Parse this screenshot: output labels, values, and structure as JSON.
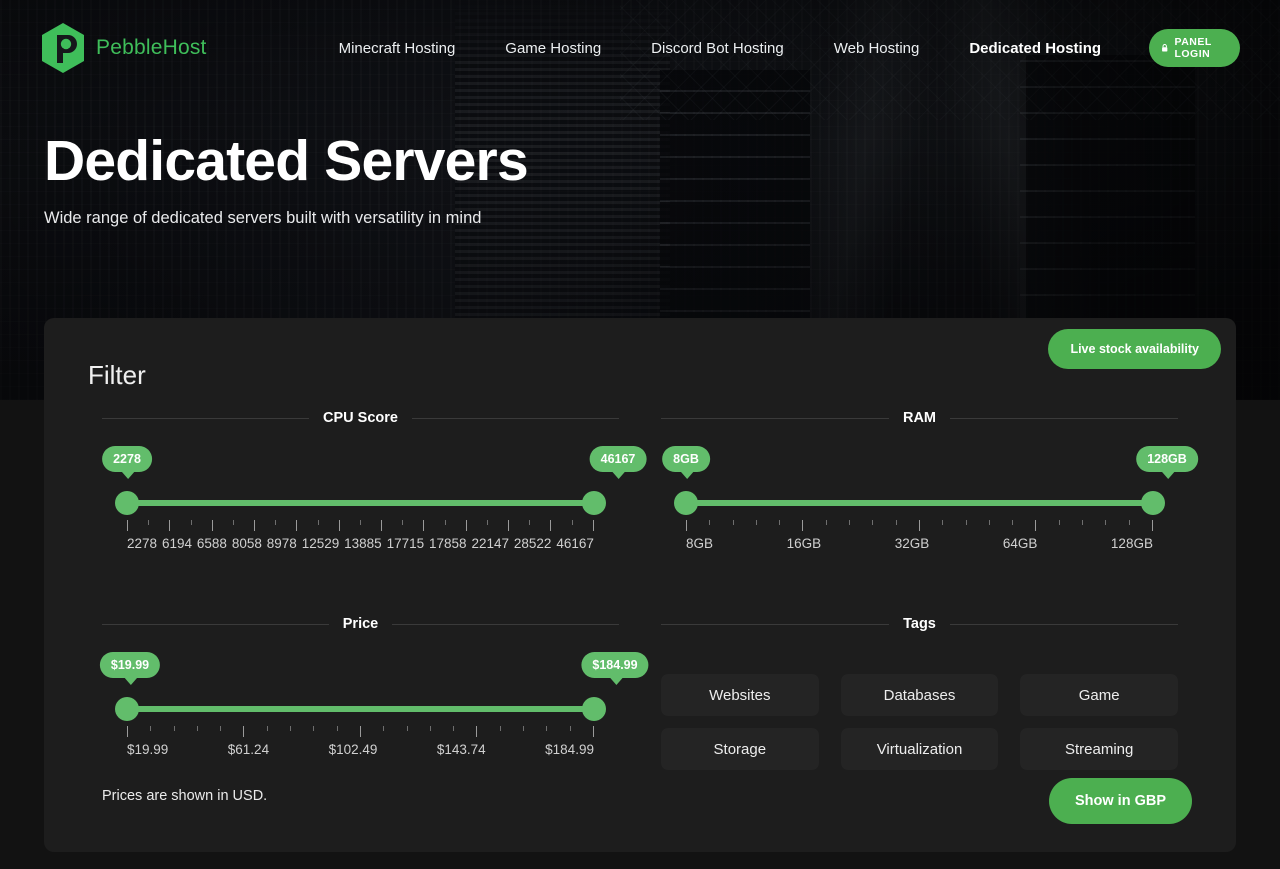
{
  "brand": {
    "name": "PebbleHost",
    "logo_icon": "pebble-hexagon-logo",
    "color": "#3fbe5a"
  },
  "nav": {
    "links": [
      {
        "label": "Minecraft Hosting",
        "active": false
      },
      {
        "label": "Game Hosting",
        "active": false
      },
      {
        "label": "Discord Bot Hosting",
        "active": false
      },
      {
        "label": "Web Hosting",
        "active": false
      },
      {
        "label": "Dedicated Hosting",
        "active": true
      }
    ],
    "panel_login": {
      "label": "PANEL LOGIN",
      "icon": "lock-icon",
      "color": "#4CAF50"
    }
  },
  "hero": {
    "title": "Dedicated Servers",
    "subtitle": "Wide range of dedicated servers built with versatility in mind"
  },
  "filter": {
    "title": "Filter",
    "live_stock_label": "Live stock availability",
    "accent_color": "#4CAF50",
    "slider_color": "#62bd6b",
    "cpu": {
      "legend": "CPU Score",
      "min_bubble": "2278",
      "max_bubble": "46167",
      "ticks": [
        "2278",
        "6194",
        "6588",
        "8058",
        "8978",
        "12529",
        "13885",
        "17715",
        "17858",
        "22147",
        "28522",
        "46167"
      ]
    },
    "ram": {
      "legend": "RAM",
      "min_bubble": "8GB",
      "max_bubble": "128GB",
      "ticks": [
        "8GB",
        "16GB",
        "32GB",
        "64GB",
        "128GB"
      ]
    },
    "price": {
      "legend": "Price",
      "min_bubble": "$19.99",
      "max_bubble": "$184.99",
      "ticks": [
        "$19.99",
        "$61.24",
        "$102.49",
        "$143.74",
        "$184.99"
      ]
    },
    "tags": {
      "legend": "Tags",
      "items": [
        "Websites",
        "Databases",
        "Game",
        "Storage",
        "Virtualization",
        "Streaming"
      ]
    },
    "footer": {
      "currency_note": "Prices are shown in USD.",
      "currency_toggle_label": "Show in GBP"
    }
  }
}
